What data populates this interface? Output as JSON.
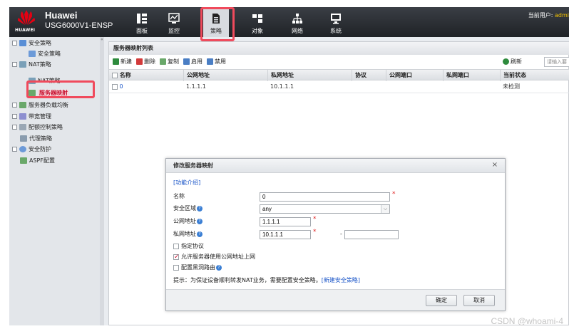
{
  "header": {
    "logo_text": "HUAWEI",
    "brand_line1": "Huawei",
    "brand_line2": "USG6000V1-ENSP",
    "user_label": "当前用户: ",
    "user_name": "admi"
  },
  "nav": [
    {
      "label": "面板",
      "icon": "dashboard-icon"
    },
    {
      "label": "监控",
      "icon": "monitor-chart-icon"
    },
    {
      "label": "策略",
      "icon": "policy-document-icon"
    },
    {
      "label": "对象",
      "icon": "object-icon"
    },
    {
      "label": "网络",
      "icon": "network-icon"
    },
    {
      "label": "系统",
      "icon": "system-monitor-icon"
    }
  ],
  "sidebar": {
    "items": [
      {
        "label": "安全策略",
        "level": 0
      },
      {
        "label": "安全策略",
        "level": 1
      },
      {
        "label": "NAT策略",
        "level": 0
      },
      {
        "label": "NAT策略",
        "level": 1
      },
      {
        "label": "服务器映射",
        "level": 1
      },
      {
        "label": "服务器负载均衡",
        "level": 0
      },
      {
        "label": "带宽管理",
        "level": 0
      },
      {
        "label": "配额控制策略",
        "level": 0
      },
      {
        "label": "代理策略",
        "level": 0
      },
      {
        "label": "安全防护",
        "level": 0
      },
      {
        "label": "ASPF配置",
        "level": 0
      }
    ]
  },
  "panel": {
    "title": "服务器映射列表",
    "toolbar": {
      "new": "新建",
      "delete": "删除",
      "copy": "复制",
      "enable": "启用",
      "disable": "禁用",
      "refresh": "刷新",
      "search_placeholder": "请输入要"
    },
    "columns": [
      "名称",
      "公网地址",
      "私网地址",
      "协议",
      "公网端口",
      "私网端口",
      "当前状态"
    ],
    "rows": [
      {
        "name": "0",
        "public_ip": "1.1.1.1",
        "private_ip": "10.1.1.1",
        "protocol": "",
        "public_port": "",
        "private_port": "",
        "status": "未检测"
      }
    ]
  },
  "dialog": {
    "title": "修改服务器映射",
    "help_link": "[功能介绍]",
    "fields": {
      "name_label": "名称",
      "name_value": "0",
      "zone_label": "安全区域",
      "zone_value": "any",
      "public_label": "公网地址",
      "public_value": "1.1.1.1",
      "private_label": "私网地址",
      "private_value": "10.1.1.1",
      "private_value2": ""
    },
    "checkboxes": {
      "protocol": "指定协议",
      "allow_public": "允许服务器使用公网地址上网",
      "blackhole": "配置黑洞路由"
    },
    "tip_text": "提示：为保证设备顺利转发NAT业务，需要配置安全策略。",
    "tip_link": "[新建安全策略]",
    "ok": "确定",
    "cancel": "取消"
  },
  "watermark": "CSDN @whoami-4",
  "colors": {
    "accent_red": "#f04a5c",
    "link_blue": "#1a55c8",
    "header_dark": "#2a2d32"
  }
}
